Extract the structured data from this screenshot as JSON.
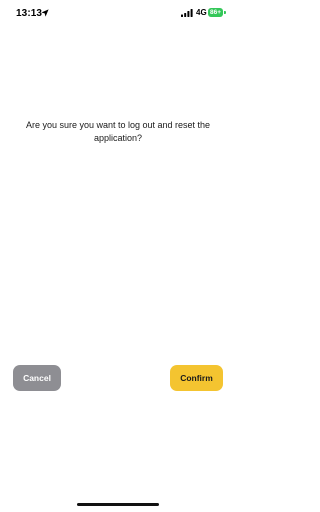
{
  "status_bar": {
    "time": "13:13",
    "location_icon": "location-arrow-icon",
    "signal_icon": "cellular-signal-icon",
    "network": "4G",
    "battery": "86+"
  },
  "dialog": {
    "message": "Are you sure you want to log out and reset the application?",
    "cancel_label": "Cancel",
    "confirm_label": "Confirm"
  },
  "colors": {
    "cancel_button": "#8e8e93",
    "confirm_button": "#f4c430",
    "battery": "#34c759"
  }
}
